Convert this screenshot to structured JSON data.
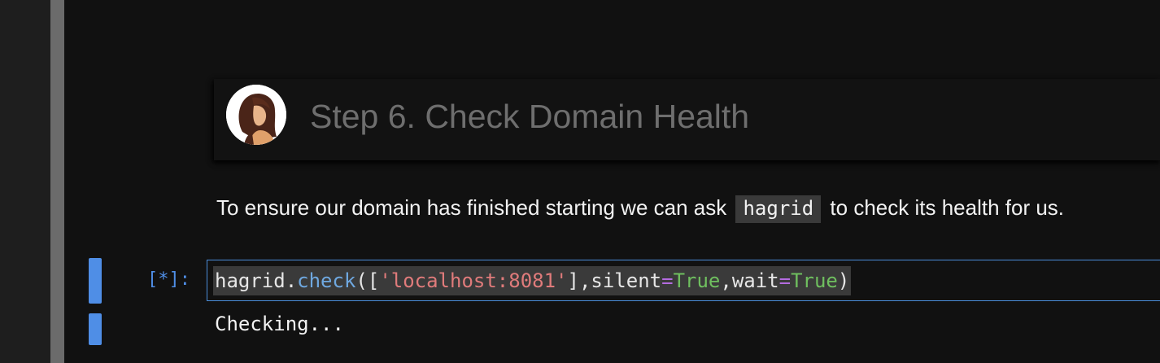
{
  "markdown": {
    "heading": "Step 6. Check Domain Health",
    "paragraph_before": "To ensure our domain has finished starting we can ask",
    "inline_code": "hagrid",
    "paragraph_after": "to check its health for us."
  },
  "code_cell": {
    "prompt": "[*]:",
    "tokens": {
      "obj": "hagrid",
      "dot": ".",
      "method": "check",
      "open": "([",
      "string": "'localhost:8081'",
      "close_list": "],",
      "arg1": "silent",
      "eq1": "=",
      "val1": "True",
      "comma": ",",
      "arg2": "wait",
      "eq2": "=",
      "val2": "True",
      "close": ")"
    },
    "output": "Checking..."
  },
  "colors": {
    "accent": "#4f8ee6",
    "string": "#e07b7b",
    "keyword": "#6fbf5f",
    "operator": "#b36be0"
  }
}
